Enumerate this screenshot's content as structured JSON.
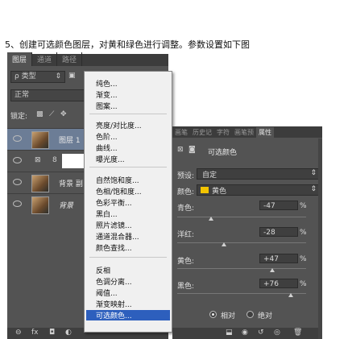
{
  "instruction": "5、创建可选颜色图层，对黄和绿色进行调整。参数设置如下图",
  "layers_panel": {
    "tabs": [
      "图层",
      "通道",
      "路径"
    ],
    "filter_label": "ρ 类型",
    "blend_mode": "正常",
    "lock_label": "锁定:",
    "layers": [
      {
        "name": "图层 1"
      },
      {
        "name": ""
      },
      {
        "name": "背景 副"
      },
      {
        "name": "背景"
      }
    ]
  },
  "menu": {
    "groups": [
      [
        "纯色...",
        "渐变...",
        "图案..."
      ],
      [
        "亮度/对比度...",
        "色阶...",
        "曲线...",
        "曝光度..."
      ],
      [
        "自然饱和度...",
        "色相/饱和度...",
        "色彩平衡...",
        "黑白...",
        "照片滤镜...",
        "通道混合器...",
        "颜色查找..."
      ],
      [
        "反相",
        "色调分离...",
        "阈值...",
        "渐变映射...",
        "可选颜色..."
      ]
    ],
    "highlighted": "可选颜色..."
  },
  "properties_panel": {
    "tabs": [
      "画笔",
      "历史记",
      "字符",
      "画笔预",
      "属性"
    ],
    "title": "可选颜色",
    "preset_label": "预设:",
    "preset_value": "自定",
    "colors_label": "颜色:",
    "colors_value": "黄色",
    "swatch_color": "#f3c400",
    "sliders": [
      {
        "label": "青色:",
        "value": "-47",
        "fraction": 0.265
      },
      {
        "label": "洋红:",
        "value": "-28",
        "fraction": 0.36
      },
      {
        "label": "黄色:",
        "value": "+47",
        "fraction": 0.735
      },
      {
        "label": "黑色:",
        "value": "+76",
        "fraction": 0.88
      }
    ],
    "percent": "%",
    "radio_relative": "相对",
    "radio_absolute": "绝对"
  }
}
